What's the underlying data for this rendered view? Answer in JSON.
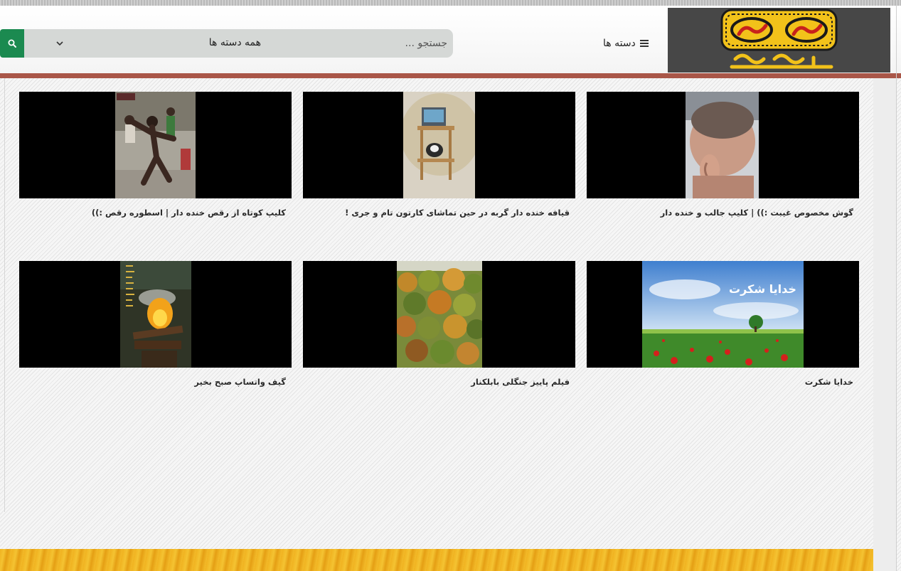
{
  "header": {
    "logo_text": "گیف گیف",
    "categories_label": "دسته ها",
    "search": {
      "placeholder": "جستجو ...",
      "selected_category": "همه دسته ها"
    }
  },
  "videos": [
    {
      "title": "گوش مخصوص غیبت :)) | کلیپ جالب و خنده دار",
      "watermark": ""
    },
    {
      "title": "قیافه خنده دار گربه در حین تماشای کارتون تام و جری !",
      "watermark": ""
    },
    {
      "title": "کلیپ کوتاه از رقص خنده دار | اسطوره رقص :))",
      "watermark": ""
    },
    {
      "title": "خدایا شکرت",
      "overlay_text": "خدایا شکرت"
    },
    {
      "title": "فیلم پاییز جنگلی بابلکنار",
      "watermark": ""
    },
    {
      "title": "گیف واتساپ صبح بخیر",
      "watermark": ""
    }
  ],
  "colors": {
    "brand_red": "#a95648",
    "search_button": "#1b8a50",
    "logo_bg": "#474747",
    "logo_yellow": "#f2c21a"
  }
}
